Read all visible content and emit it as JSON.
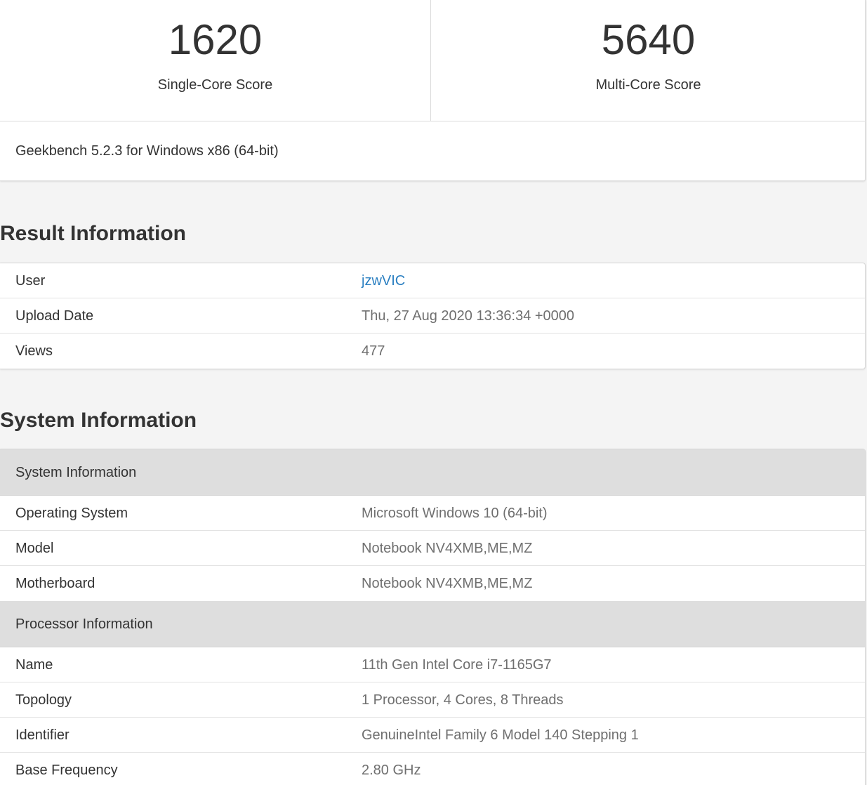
{
  "scores": {
    "single_value": "1620",
    "single_label": "Single-Core Score",
    "multi_value": "5640",
    "multi_label": "Multi-Core Score",
    "version": "Geekbench 5.2.3 for Windows x86 (64-bit)"
  },
  "result_info": {
    "title": "Result Information",
    "rows": [
      {
        "key": "User",
        "value": "jzwVIC"
      },
      {
        "key": "Upload Date",
        "value": "Thu, 27 Aug 2020 13:36:34 +0000"
      },
      {
        "key": "Views",
        "value": "477"
      }
    ]
  },
  "system_info": {
    "title": "System Information",
    "groups": [
      {
        "header": "System Information",
        "rows": [
          {
            "key": "Operating System",
            "value": "Microsoft Windows 10 (64-bit)"
          },
          {
            "key": "Model",
            "value": "Notebook NV4XMB,ME,MZ"
          },
          {
            "key": "Motherboard",
            "value": "Notebook NV4XMB,ME,MZ"
          }
        ]
      },
      {
        "header": "Processor Information",
        "rows": [
          {
            "key": "Name",
            "value": "11th Gen Intel Core i7-1165G7"
          },
          {
            "key": "Topology",
            "value": "1 Processor, 4 Cores, 8 Threads"
          },
          {
            "key": "Identifier",
            "value": "GenuineIntel Family 6 Model 140 Stepping 1"
          },
          {
            "key": "Base Frequency",
            "value": "2.80 GHz"
          }
        ]
      }
    ]
  },
  "colors": {
    "link": "#2a7fc1",
    "group_header_bg": "#dedede",
    "page_bg": "#f4f4f4"
  }
}
